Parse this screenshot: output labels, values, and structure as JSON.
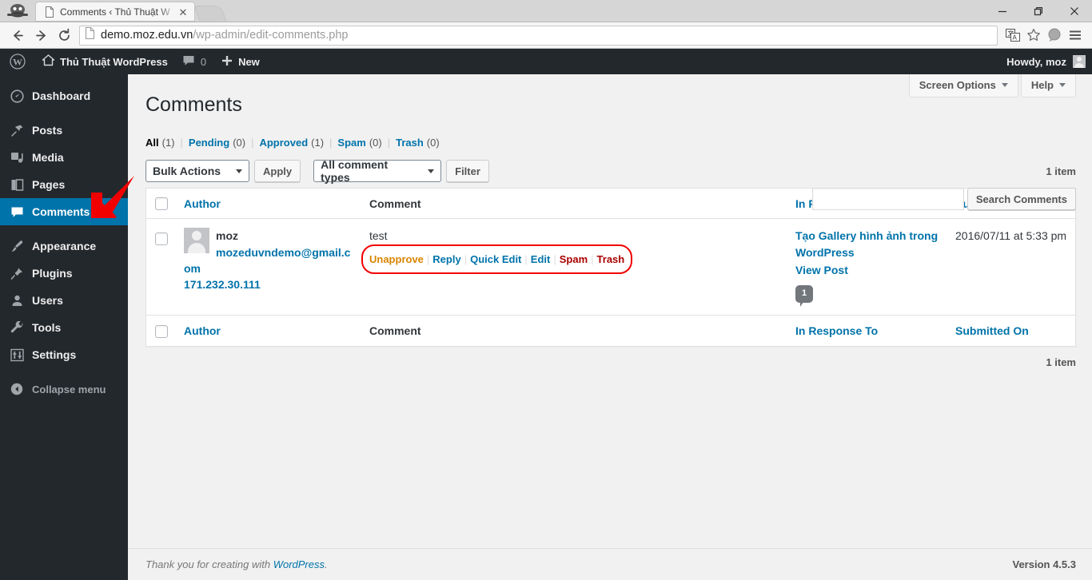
{
  "browser": {
    "tab_title": "Comments ‹ Thủ Thuật W",
    "url_host": "demo.moz.edu.vn",
    "url_path": "/wp-admin/edit-comments.php",
    "back_icon": "back-arrow-icon",
    "forward_icon": "forward-arrow-icon",
    "reload_icon": "reload-icon",
    "translate_icon": "translate-icon",
    "bookmark_icon": "star-icon",
    "profile_icon": "profile-icon",
    "menu_icon": "hamburger-menu-icon",
    "minimize": "—",
    "maximize": "❐",
    "close": "✕",
    "tab_close": "✕"
  },
  "adminbar": {
    "logo_label": "wordpress-logo",
    "site_name": "Thủ Thuật WordPress",
    "comment_count": "0",
    "new_label": "New",
    "howdy": "Howdy, moz"
  },
  "sidebar": {
    "items": [
      {
        "label": "Dashboard",
        "icon": "dashboard-icon",
        "current": false
      },
      {
        "label": "Posts",
        "icon": "pin-icon",
        "current": false
      },
      {
        "label": "Media",
        "icon": "media-icon",
        "current": false
      },
      {
        "label": "Pages",
        "icon": "page-icon",
        "current": false
      },
      {
        "label": "Comments",
        "icon": "comment-icon",
        "current": true
      },
      {
        "label": "Appearance",
        "icon": "brush-icon",
        "current": false
      },
      {
        "label": "Plugins",
        "icon": "plug-icon",
        "current": false
      },
      {
        "label": "Users",
        "icon": "user-icon",
        "current": false
      },
      {
        "label": "Tools",
        "icon": "wrench-icon",
        "current": false
      },
      {
        "label": "Settings",
        "icon": "sliders-icon",
        "current": false
      }
    ],
    "collapse_label": "Collapse menu"
  },
  "screen_meta": {
    "screen_options": "Screen Options",
    "help": "Help"
  },
  "page": {
    "title": "Comments"
  },
  "filters": {
    "all": {
      "label": "All",
      "count": "(1)"
    },
    "pending": {
      "label": "Pending",
      "count": "(0)"
    },
    "approved": {
      "label": "Approved",
      "count": "(1)"
    },
    "spam": {
      "label": "Spam",
      "count": "(0)"
    },
    "trash": {
      "label": "Trash",
      "count": "(0)"
    },
    "divider": "|"
  },
  "search": {
    "value": "",
    "placeholder": "",
    "button_label": "Search Comments"
  },
  "tablenav": {
    "bulk_actions": "Bulk Actions",
    "apply": "Apply",
    "comment_types": "All comment types",
    "filter": "Filter",
    "displaying_num": "1 item",
    "displaying_num_bottom": "1 item"
  },
  "table": {
    "columns": {
      "author": "Author",
      "comment": "Comment",
      "response": "In Response To",
      "date": "Submitted On"
    },
    "rows": [
      {
        "author_name": "moz",
        "author_email": "mozeduvndemo@gmail.com",
        "author_ip": "171.232.30.111",
        "comment_text": "test",
        "actions": [
          {
            "label": "Unapprove",
            "style": "unapprove"
          },
          {
            "label": "Reply",
            "style": "blue"
          },
          {
            "label": "Quick Edit",
            "style": "blue"
          },
          {
            "label": "Edit",
            "style": "blue"
          },
          {
            "label": "Spam",
            "style": "red"
          },
          {
            "label": "Trash",
            "style": "red"
          }
        ],
        "action_separator": "|",
        "response_post": "Tạo Gallery hình ảnh trong WordPress",
        "view_post": "View Post",
        "post_comment_count": "1",
        "submitted_on": "2016/07/11 at 5:33 pm"
      }
    ]
  },
  "footer": {
    "thank_you_prefix": "Thank you for creating with ",
    "wordpress_link": "WordPress",
    "thank_you_suffix": ".",
    "version": "Version 4.5.3"
  },
  "colors": {
    "admin_dark": "#23282d",
    "accent_blue": "#0073aa",
    "annotation_red": "#f20000",
    "unapprove_orange": "#d98500",
    "danger_red": "#a00"
  }
}
